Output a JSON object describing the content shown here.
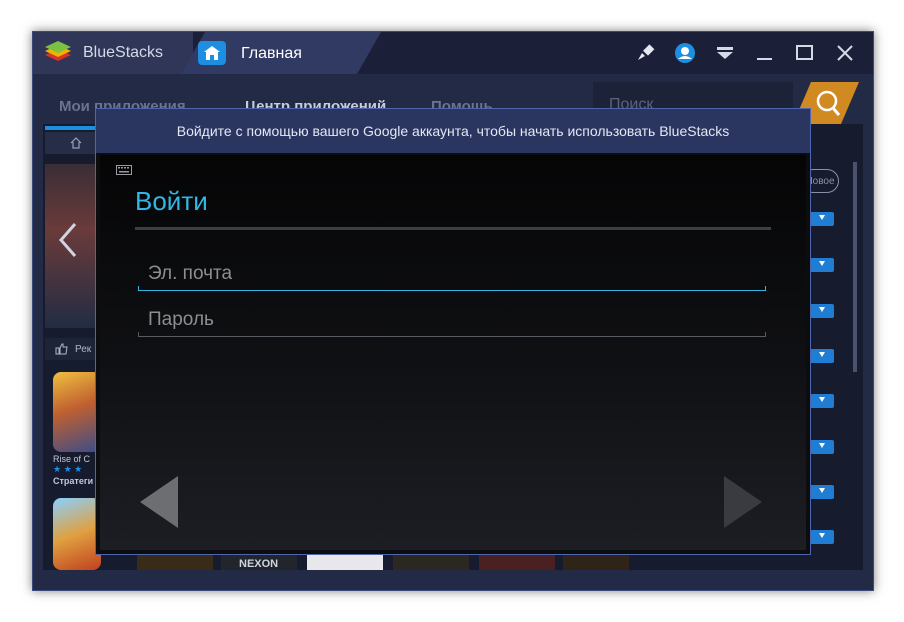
{
  "window": {
    "app_name": "BlueStacks",
    "tab_title": "Главная"
  },
  "nav": {
    "items": [
      "Мои приложения",
      "Центр приложений",
      "Помощь"
    ],
    "search_placeholder": "Поиск"
  },
  "background": {
    "recommend_label": "Рек",
    "new_badge": "Новое",
    "games": [
      {
        "name": "Rise of C",
        "rating": "★ ★ ★",
        "genre": "Стратеги"
      }
    ],
    "strip_label": "NEXON"
  },
  "dialog": {
    "header": "Войдите с помощью вашего Google аккаунта, чтобы начать использовать BlueStacks",
    "title": "Войти",
    "email_placeholder": "Эл. почта",
    "password_placeholder": "Пароль"
  },
  "colors": {
    "accent_blue": "#33b5e5",
    "dialog_header": "#2a3560",
    "download_button": "#1f7dd3",
    "search_button": "#d18a22"
  }
}
